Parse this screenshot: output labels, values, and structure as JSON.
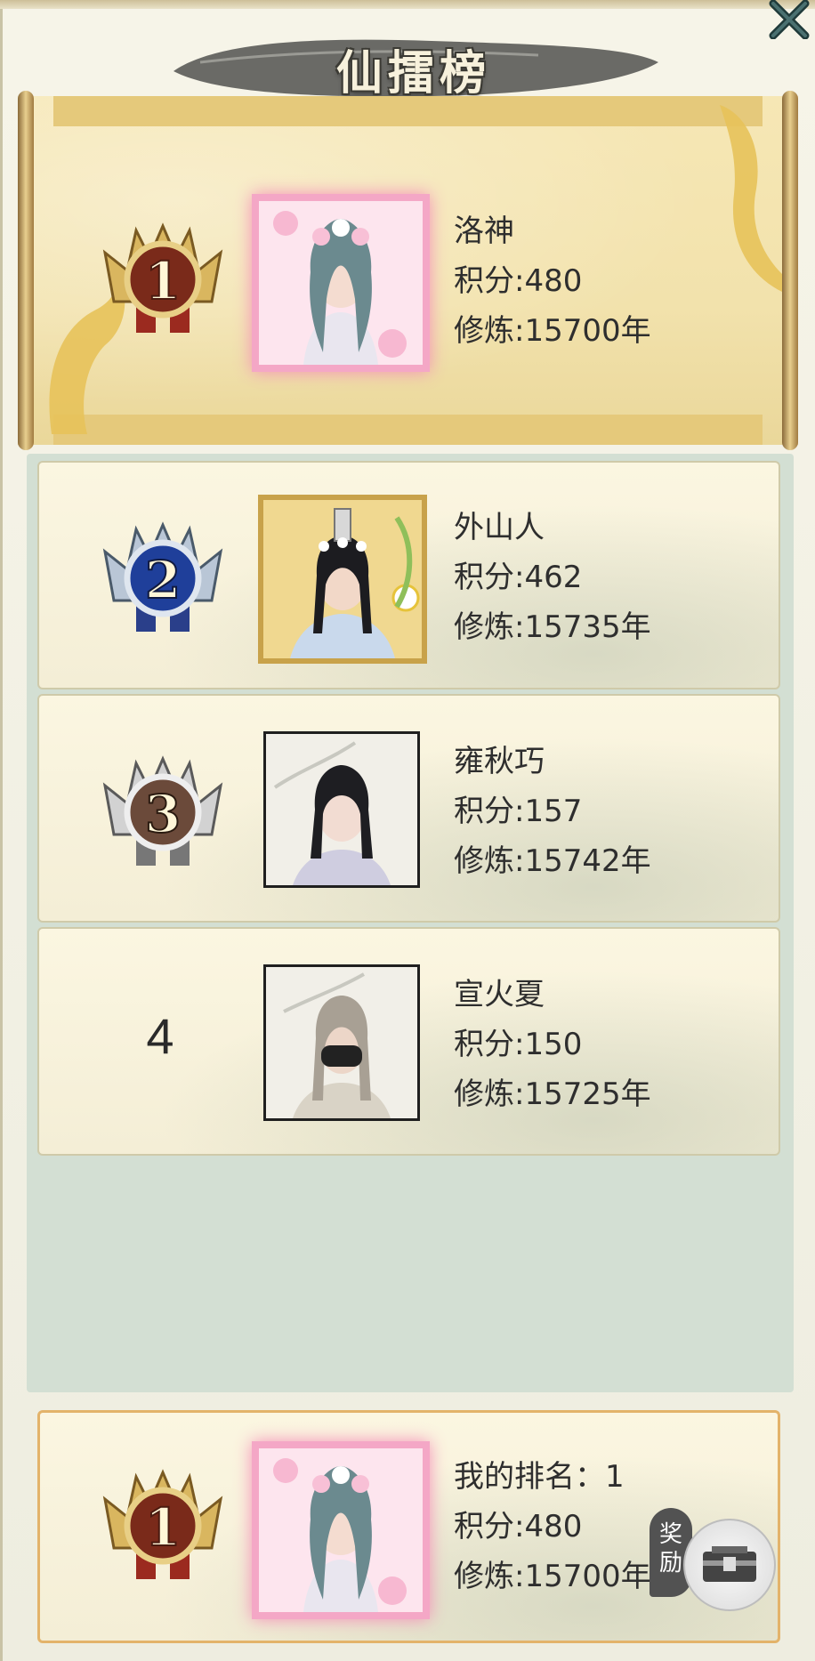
{
  "title": "仙擂榜",
  "ranking": [
    {
      "rank": 1,
      "rank_label": "1",
      "name": "洛神",
      "score": "积分:480",
      "cultivation": "修炼:15700年",
      "frame": "pink"
    },
    {
      "rank": 2,
      "rank_label": "2",
      "name": "外山人",
      "score": "积分:462",
      "cultivation": "修炼:15735年",
      "frame": "gold"
    },
    {
      "rank": 3,
      "rank_label": "3",
      "name": "雍秋巧",
      "score": "积分:157",
      "cultivation": "修炼:15742年",
      "frame": "plain"
    },
    {
      "rank": 4,
      "rank_label": "4",
      "name": "宣火夏",
      "score": "积分:150",
      "cultivation": "修炼:15725年",
      "frame": "plain"
    }
  ],
  "my_rank": {
    "rank_label": "1",
    "rank_text": "我的排名：1",
    "score": "积分:480",
    "cultivation": "修炼:15700年"
  },
  "reward": {
    "label": "奖励"
  },
  "icons": {
    "close": "close-icon",
    "medal_gold": "gold-medal-icon",
    "medal_blue": "blue-medal-icon",
    "medal_silver": "silver-medal-icon",
    "reward": "treasure-chest-icon"
  },
  "colors": {
    "gold_medal": "#7a2a1a",
    "blue_medal": "#1f3f9a",
    "silver_medal": "#6b6b6b",
    "list_bg": "#d3dfd3"
  }
}
